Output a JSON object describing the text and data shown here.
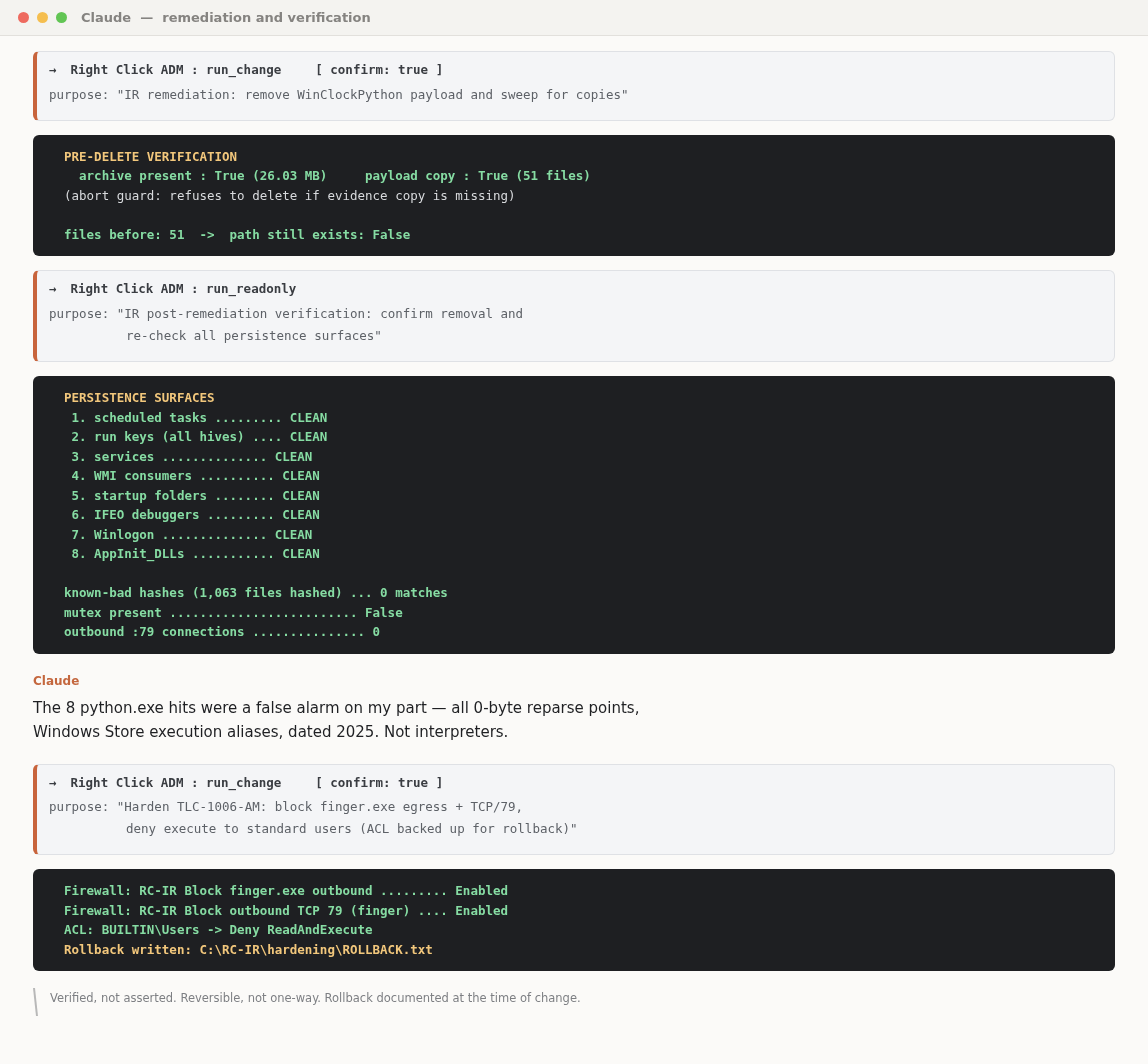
{
  "window": {
    "title": "Claude  —  remediation and verification"
  },
  "blocks": [
    {
      "kind": "call",
      "arrow": "→",
      "tool": "Right Click ADM : run_change",
      "confirm": "[ confirm: true ]",
      "purpose": [
        "purpose: \"IR remediation: remove WinClockPython payload and sweep for copies\""
      ]
    },
    {
      "kind": "output",
      "groups": [
        [
          {
            "kind": "heading",
            "text": "PRE-DELETE VERIFICATION"
          },
          {
            "kind": "ok",
            "text": "  archive present : True (26.03 MB)     payload copy : True (51 files)"
          },
          {
            "kind": "comment",
            "text": "(abort guard: refuses to delete if evidence copy is missing)"
          }
        ],
        [
          {
            "kind": "ok",
            "text": "files before: 51  ->  path still exists: False"
          }
        ]
      ]
    },
    {
      "kind": "call",
      "arrow": "→",
      "tool": "Right Click ADM : run_readonly",
      "purpose": [
        "purpose: \"IR post-remediation verification: confirm removal and",
        "re-check all persistence surfaces\""
      ]
    },
    {
      "kind": "output",
      "groups": [
        [
          {
            "kind": "heading",
            "text": "PERSISTENCE SURFACES"
          },
          {
            "kind": "ok",
            "text": " 1. scheduled tasks ......... CLEAN"
          },
          {
            "kind": "ok",
            "text": " 2. run keys (all hives) .... CLEAN"
          },
          {
            "kind": "ok",
            "text": " 3. services .............. CLEAN"
          },
          {
            "kind": "ok",
            "text": " 4. WMI consumers .......... CLEAN"
          },
          {
            "kind": "ok",
            "text": " 5. startup folders ........ CLEAN"
          },
          {
            "kind": "ok",
            "text": " 6. IFEO debuggers ......... CLEAN"
          },
          {
            "kind": "ok",
            "text": " 7. Winlogon .............. CLEAN"
          },
          {
            "kind": "ok",
            "text": " 8. AppInit_DLLs ........... CLEAN"
          }
        ],
        [
          {
            "kind": "ok",
            "text": "known-bad hashes (1,063 files hashed) ... 0 matches"
          },
          {
            "kind": "ok",
            "text": "mutex present ......................... False"
          },
          {
            "kind": "ok",
            "text": "outbound :79 connections ............... 0"
          }
        ]
      ]
    },
    {
      "kind": "message",
      "author": "Claude",
      "lines": [
        "The 8 python.exe hits were a false alarm on my part — all 0-byte reparse points,",
        "Windows Store execution aliases, dated 2025. Not interpreters."
      ]
    },
    {
      "kind": "call",
      "arrow": "→",
      "tool": "Right Click ADM : run_change",
      "confirm": "[ confirm: true ]",
      "purpose": [
        "purpose: \"Harden TLC-1006-AM: block finger.exe egress + TCP/79,",
        "deny execute to standard users (ACL backed up for rollback)\""
      ]
    },
    {
      "kind": "output",
      "groups": [
        [
          {
            "kind": "ok",
            "text": "Firewall: RC-IR Block finger.exe outbound ......... Enabled"
          },
          {
            "kind": "ok",
            "text": "Firewall: RC-IR Block outbound TCP 79 (finger) .... Enabled"
          },
          {
            "kind": "ok",
            "text": "ACL: BUILTIN\\Users -> Deny ReadAndExecute"
          },
          {
            "kind": "heading",
            "text": "Rollback written: C:\\RC-IR\\hardening\\ROLLBACK.txt"
          }
        ]
      ]
    },
    {
      "kind": "note",
      "text": "Verified, not asserted. Reversible, not one-way. Rollback documented at the time of change."
    }
  ]
}
